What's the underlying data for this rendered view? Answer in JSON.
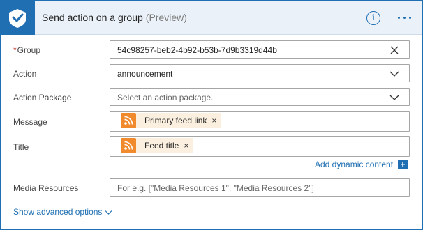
{
  "header": {
    "title": "Send action on a group",
    "preview": "(Preview)",
    "info_glyph": "i",
    "brand_color": "#1f6fb2"
  },
  "fields": {
    "group": {
      "required_mark": "*",
      "label": "Group",
      "value": "54c98257-beb2-4b92-b53b-7d9b3319d44b"
    },
    "action": {
      "label": "Action",
      "value": "announcement"
    },
    "action_package": {
      "label": "Action Package",
      "placeholder": "Select an action package."
    },
    "message": {
      "label": "Message",
      "token": "Primary feed link",
      "token_remove": "×"
    },
    "title": {
      "label": "Title",
      "token": "Feed title",
      "token_remove": "×"
    },
    "media_resources": {
      "label": "Media Resources",
      "placeholder": "For e.g. [\"Media Resources 1\", \"Media Resources 2\"]"
    }
  },
  "add_dynamic_content": {
    "label": "Add dynamic content",
    "plus": "+"
  },
  "show_advanced": {
    "label": "Show advanced options"
  },
  "token_color": "#fbefdf",
  "rss_color": "#f18a2c"
}
